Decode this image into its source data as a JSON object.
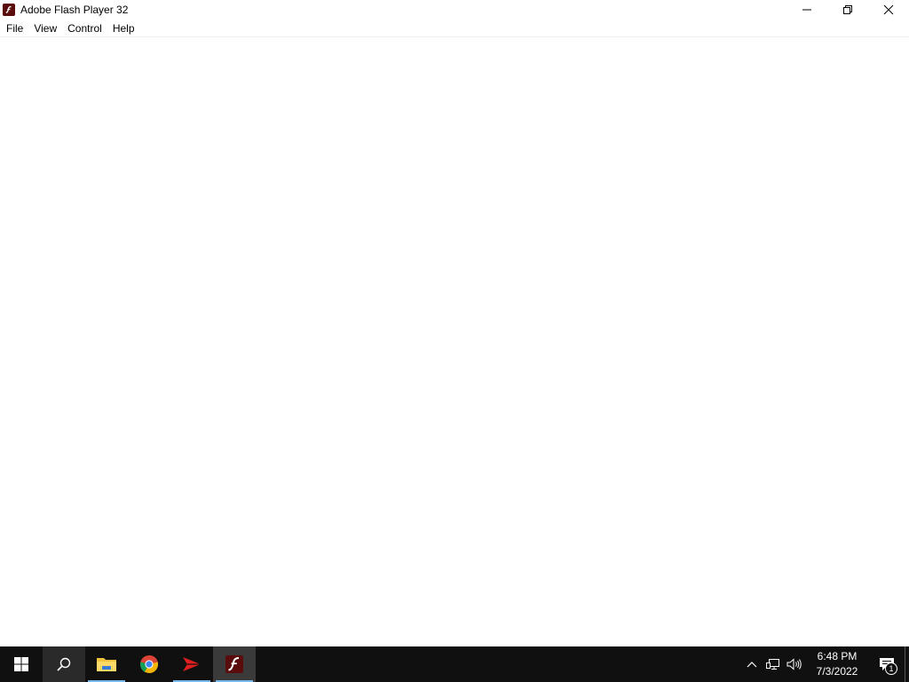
{
  "window": {
    "title": "Adobe Flash Player 32",
    "app_icon": "flash-player-icon",
    "controls": [
      "minimize-icon",
      "restore-icon",
      "close-icon"
    ]
  },
  "menu": {
    "items": [
      {
        "label": "File"
      },
      {
        "label": "View"
      },
      {
        "label": "Control"
      },
      {
        "label": "Help"
      }
    ]
  },
  "taskbar": {
    "buttons": [
      {
        "name": "start",
        "icon": "windows-logo-icon"
      },
      {
        "name": "search",
        "icon": "search-icon"
      },
      {
        "name": "file-explorer",
        "icon": "folder-icon"
      },
      {
        "name": "chrome",
        "icon": "chrome-icon"
      },
      {
        "name": "app-red-arrow",
        "icon": "red-arrow-icon"
      },
      {
        "name": "flash-player",
        "icon": "flash-player-icon"
      }
    ],
    "tray": {
      "icons": [
        "chevron-up-icon",
        "network-icon",
        "volume-icon"
      ],
      "time": "6:48 PM",
      "date": "7/3/2022",
      "notification_count": "1"
    }
  },
  "colors": {
    "taskbar_bg": "#101010",
    "flash_red": "#5a0b0b",
    "active_underline": "#76b9ed"
  }
}
